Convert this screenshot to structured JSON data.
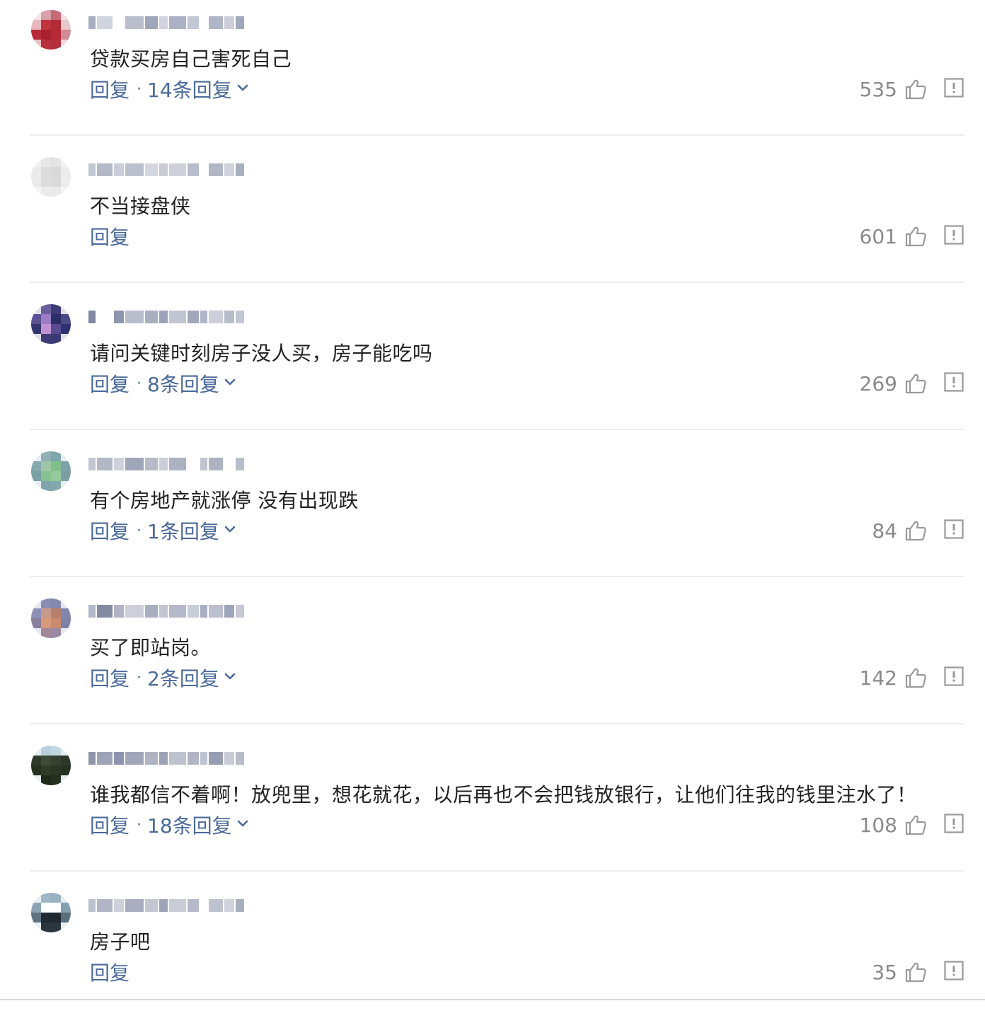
{
  "comments": [
    {
      "text": "贷款买房自己害死自己",
      "reply_label": "回复",
      "reply_count_label": "14条回复",
      "likes": "535",
      "avatar_colors": [
        "#f4e4e6",
        "#d8a0a8",
        "#c76a78",
        "#f3dee1",
        "#e6b7bd",
        "#c0343f",
        "#b12a35",
        "#e8c8cc",
        "#b82a37",
        "#a8202c",
        "#b52834",
        "#d28a94",
        "#e9c0c5",
        "#b8323d",
        "#b3303b",
        "#f2d8db"
      ],
      "name_colors": [
        "#9aa0b6",
        "#c8ccd8",
        "#ffffff",
        "#aeb3c4",
        "#8f96ad",
        "#c9cdd8",
        "#9ea4ba",
        "#b8bccb",
        "#ffffff",
        "#a2a8bd",
        "#c3c7d3",
        "#9299b0"
      ]
    },
    {
      "text": "不当接盘侠",
      "reply_label": "回复",
      "reply_count_label": "",
      "likes": "601",
      "avatar_colors": [
        "#f2f2f2",
        "#e8e8e8",
        "#e4e4e4",
        "#f2f2f2",
        "#ebebeb",
        "#dcdcdc",
        "#d9d9d9",
        "#ececec",
        "#ebebeb",
        "#dddddd",
        "#dadada",
        "#ececec",
        "#f4f4f4",
        "#ececec",
        "#eaeaea",
        "#f4f4f4"
      ],
      "name_colors": [
        "#b9bdc9",
        "#a7acbd",
        "#c2c6d1",
        "#b0b5c4",
        "#cdd0da",
        "#bfc3ce",
        "#c6c9d3",
        "#adb2c2",
        "#ffffff",
        "#a4a9bb",
        "#c8cbd5",
        "#9ba1b5"
      ]
    },
    {
      "text": "请问关键时刻房子没人买，房子能吃吗",
      "reply_label": "回复",
      "reply_count_label": "8条回复",
      "likes": "269",
      "avatar_colors": [
        "#dfe0ec",
        "#6a5e9c",
        "#3d3b7a",
        "#dfe0ec",
        "#5b5394",
        "#9c7cc4",
        "#2c2e6a",
        "#4a4b86",
        "#34346e",
        "#c291d4",
        "#5a4a90",
        "#2f3070",
        "#dfe0ec",
        "#3f3c78",
        "#3a3a74",
        "#dfe0ec"
      ],
      "name_colors": [
        "#6c7390",
        "#ffffff",
        "#7c83a0",
        "#adb2c2",
        "#9aa0b6",
        "#8b92ab",
        "#b7bbca",
        "#9298b0",
        "#a4a9bc",
        "#c3c6d2",
        "#adb1c1",
        "#b9bdcb"
      ]
    },
    {
      "text": "有个房地产就涨停 没有出现跌",
      "reply_label": "回复",
      "reply_count_label": "1条回复",
      "likes": "84",
      "avatar_colors": [
        "#e8eef0",
        "#8fb0b4",
        "#7fa6ac",
        "#e8eef0",
        "#86a9ae",
        "#9fc7a6",
        "#7fbf8a",
        "#7ea4aa",
        "#7aa0a6",
        "#86c392",
        "#94ca9e",
        "#799fa5",
        "#e8eef0",
        "#7fa5ab",
        "#82a7ad",
        "#e8eef0"
      ],
      "name_colors": [
        "#b8bccb",
        "#a6abbd",
        "#c6c9d4",
        "#8f96ad",
        "#a9aec0",
        "#c2c6d1",
        "#9ea4b9",
        "#ffffff",
        "#b5b9c8",
        "#a0a6ba",
        "#ffffff",
        "#aeb2c2"
      ]
    },
    {
      "text": "买了即站岗。",
      "reply_label": "回复",
      "reply_count_label": "2条回复",
      "likes": "142",
      "avatar_colors": [
        "#e6e8f0",
        "#8a8eb4",
        "#8589b0",
        "#e6e8f0",
        "#8d91b6",
        "#c59a8a",
        "#b8806c",
        "#8286ad",
        "#8a7f9c",
        "#d89a7a",
        "#c98a6e",
        "#7d82aa",
        "#e6e8f0",
        "#a2889a",
        "#9a8aa4",
        "#e6e8f0"
      ],
      "name_colors": [
        "#a7acbe",
        "#6f7692",
        "#a2a7ba",
        "#c4c7d2",
        "#9aa0b5",
        "#b9bdcb",
        "#a8adbf",
        "#c0c4d0",
        "#9ba1b6",
        "#b0b4c4",
        "#8e95ac",
        "#bcc0cd"
      ]
    },
    {
      "text": "谁我都信不着啊！放兜里，想花就花，以后再也不会把钱放银行，让他们往我的钱里注水了！",
      "reply_label": "回复",
      "reply_count_label": "18条回复",
      "likes": "108",
      "avatar_colors": [
        "#e8eef2",
        "#b9d0dc",
        "#c4d8e2",
        "#e8eef2",
        "#2f3a2c",
        "#3c4a36",
        "#344030",
        "#2b3628",
        "#26311f",
        "#2f3b27",
        "#2a3524",
        "#273120",
        "#e8eef2",
        "#1f2a18",
        "#25301d",
        "#e8eef2"
      ],
      "name_colors": [
        "#7c839e",
        "#8d93ab",
        "#7a81a0",
        "#9096ae",
        "#a1a6ba",
        "#8c92aa",
        "#b4b8c8",
        "#a3a8bb",
        "#b5b9c8",
        "#858ca5",
        "#bfc2cf",
        "#adb1c1"
      ]
    },
    {
      "text": "房子吧",
      "reply_label": "回复",
      "reply_count_label": "",
      "likes": "35",
      "avatar_colors": [
        "#e9eef2",
        "#9fb6c4",
        "#9ab2c0",
        "#e9eef2",
        "#8aa2b2",
        "#ffffff",
        "#ffffff",
        "#86a0b0",
        "#5e7282",
        "#1f2a32",
        "#20292f",
        "#5a6f7e",
        "#e9eef2",
        "#2a3540",
        "#2b3641",
        "#e9eef2"
      ],
      "name_colors": [
        "#b2b6c6",
        "#a3a8bb",
        "#c5c8d3",
        "#9aa0b5",
        "#b8bccb",
        "#8d93ab",
        "#c0c3cf",
        "#a8adbf",
        "#ffffff",
        "#b3b7c6",
        "#c8cbd5",
        "#9aa0b4"
      ]
    }
  ],
  "colors": {
    "link": "#4a6a9a",
    "text": "#222222",
    "muted": "#8a8a8a",
    "divider": "#ececec"
  },
  "icons": {
    "like": "thumbs-up-icon",
    "report": "report-icon",
    "chevron": "chevron-down-icon"
  }
}
